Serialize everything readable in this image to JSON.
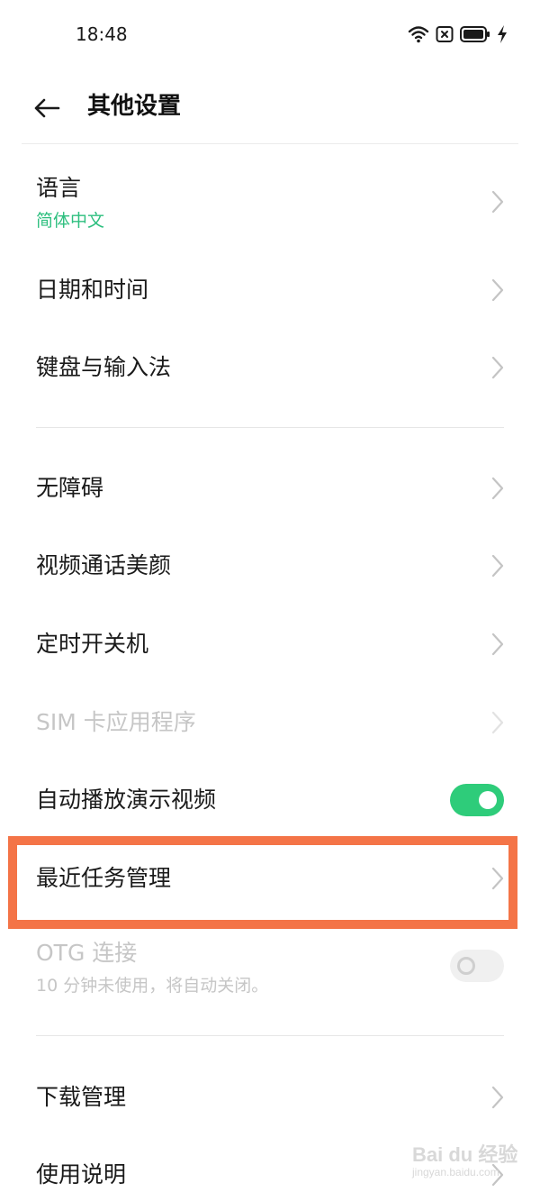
{
  "status_bar": {
    "time": "18:48",
    "icons": [
      "wifi-icon",
      "sim-off-icon",
      "battery-icon",
      "charging-icon"
    ]
  },
  "header": {
    "back_icon": "arrow-left-icon",
    "title": "其他设置"
  },
  "items": [
    {
      "title": "语言",
      "subtitle": "简体中文",
      "control": "chevron",
      "enabled": true
    },
    {
      "title": "日期和时间",
      "control": "chevron",
      "enabled": true
    },
    {
      "title": "键盘与输入法",
      "control": "chevron",
      "enabled": true
    },
    {
      "title": "无障碍",
      "control": "chevron",
      "enabled": true
    },
    {
      "title": "视频通话美颜",
      "control": "chevron",
      "enabled": true
    },
    {
      "title": "定时开关机",
      "control": "chevron",
      "enabled": true
    },
    {
      "title": "SIM 卡应用程序",
      "control": "chevron",
      "enabled": false
    },
    {
      "title": "自动播放演示视频",
      "control": "toggle",
      "toggle_on": true,
      "enabled": true
    },
    {
      "title": "最近任务管理",
      "control": "chevron",
      "enabled": true,
      "highlighted": true
    },
    {
      "title": "OTG 连接",
      "subtitle": "10 分钟未使用，将自动关闭。",
      "control": "toggle",
      "toggle_on": false,
      "enabled": false
    },
    {
      "title": "下载管理",
      "control": "chevron",
      "enabled": true
    },
    {
      "title": "使用说明",
      "control": "chevron",
      "enabled": true
    }
  ],
  "colors": {
    "accent_green": "#2ecc7a",
    "subtitle_green": "#2ebf7f",
    "highlight": "#f47447",
    "disabled_text": "#c6c6c6"
  },
  "watermark": {
    "main": "Bai du 经验",
    "sub": "jingyan.baidu.com"
  }
}
